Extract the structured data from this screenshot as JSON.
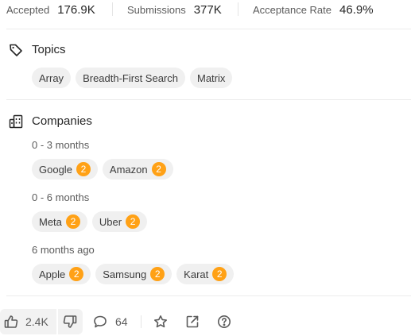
{
  "stats": {
    "accepted_label": "Accepted",
    "accepted_value": "176.9K",
    "submissions_label": "Submissions",
    "submissions_value": "377K",
    "acceptance_label": "Acceptance Rate",
    "acceptance_value": "46.9%"
  },
  "topics": {
    "title": "Topics",
    "icon": "tag-icon",
    "tags": [
      "Array",
      "Breadth-First Search",
      "Matrix"
    ]
  },
  "companies": {
    "title": "Companies",
    "icon": "building-icon",
    "groups": [
      {
        "period": "0 - 3 months",
        "items": [
          {
            "name": "Google",
            "count": "2"
          },
          {
            "name": "Amazon",
            "count": "2"
          }
        ]
      },
      {
        "period": "0 - 6 months",
        "items": [
          {
            "name": "Meta",
            "count": "2"
          },
          {
            "name": "Uber",
            "count": "2"
          }
        ]
      },
      {
        "period": "6 months ago",
        "items": [
          {
            "name": "Apple",
            "count": "2"
          },
          {
            "name": "Samsung",
            "count": "2"
          },
          {
            "name": "Karat",
            "count": "2"
          }
        ]
      }
    ]
  },
  "footer": {
    "likes": "2.4K",
    "comments": "64",
    "icons": [
      "thumbs-up-icon",
      "thumbs-down-icon",
      "comment-icon",
      "star-icon",
      "share-icon",
      "help-icon"
    ]
  },
  "colors": {
    "badge": "#ffa116",
    "chip": "#f0f0f0",
    "divider": "#ececec"
  }
}
